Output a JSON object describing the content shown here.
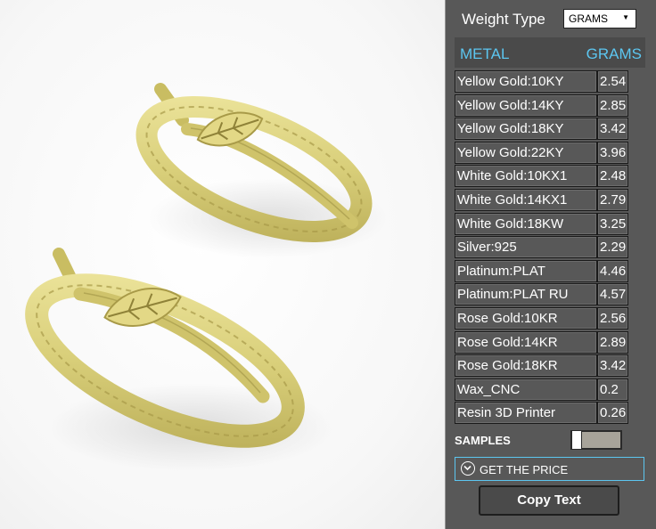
{
  "panel": {
    "weight_type_label": "Weight Type",
    "weight_type_value": "GRAMS",
    "header": {
      "metal": "METAL",
      "grams": "GRAMS"
    },
    "rows": [
      {
        "metal": "Yellow Gold:10KY",
        "grams": "2.54"
      },
      {
        "metal": "Yellow Gold:14KY",
        "grams": "2.85"
      },
      {
        "metal": "Yellow Gold:18KY",
        "grams": "3.42"
      },
      {
        "metal": "Yellow Gold:22KY",
        "grams": "3.96"
      },
      {
        "metal": "White Gold:10KX1",
        "grams": "2.48"
      },
      {
        "metal": "White Gold:14KX1",
        "grams": "2.79"
      },
      {
        "metal": "White Gold:18KW",
        "grams": "3.25"
      },
      {
        "metal": "Silver:925",
        "grams": "2.29"
      },
      {
        "metal": "Platinum:PLAT",
        "grams": "4.46"
      },
      {
        "metal": "Platinum:PLAT RU",
        "grams": "4.57"
      },
      {
        "metal": "Rose Gold:10KR",
        "grams": "2.56"
      },
      {
        "metal": "Rose Gold:14KR",
        "grams": "2.89"
      },
      {
        "metal": "Rose Gold:18KR",
        "grams": "3.42"
      },
      {
        "metal": "Wax_CNC",
        "grams": "0.2"
      },
      {
        "metal": "Resin 3D Printer",
        "grams": "0.26"
      }
    ],
    "samples_label": "SAMPLES",
    "samples_enabled": false,
    "get_price_label": "GET THE PRICE",
    "copy_text_label": "Copy Text"
  },
  "colors": {
    "panel_bg": "#585858",
    "accent": "#5cc6f0",
    "ring_gold": "#d9cf7a"
  },
  "icons": {
    "get_price": "chevron-down-circle-icon",
    "dropdown": "triangle-down-icon"
  }
}
